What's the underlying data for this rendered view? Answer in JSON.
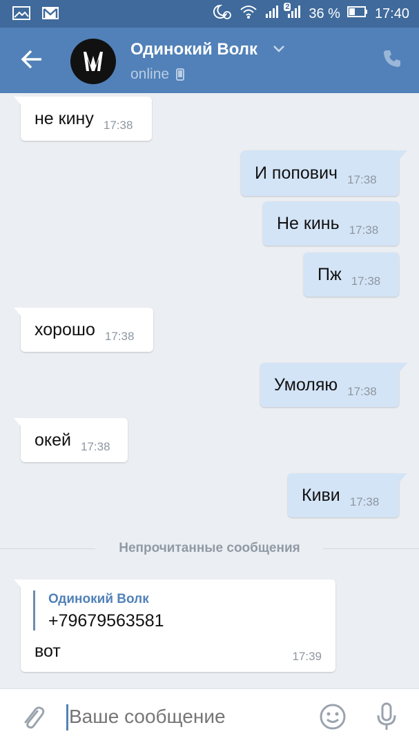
{
  "statusbar": {
    "signal_badge": "2",
    "battery": "36 %",
    "time": "17:40"
  },
  "header": {
    "name": "Одинокий Волк",
    "status": "online"
  },
  "messages": [
    {
      "dir": "in",
      "text": "не кину",
      "time": "17:38"
    },
    {
      "dir": "out",
      "text": "И попович",
      "time": "17:38"
    },
    {
      "dir": "out",
      "text": "Не кинь",
      "time": "17:38"
    },
    {
      "dir": "out",
      "text": "Пж",
      "time": "17:38"
    },
    {
      "dir": "in",
      "text": "хорошо",
      "time": "17:38"
    },
    {
      "dir": "out",
      "text": "Умоляю",
      "time": "17:38"
    },
    {
      "dir": "in",
      "text": "окей",
      "time": "17:38"
    },
    {
      "dir": "out",
      "text": "Киви",
      "time": "17:38"
    }
  ],
  "divider": "Непрочитанные сообщения",
  "forwarded": {
    "author": "Одинокий Волк",
    "quoted": "+79679563581",
    "text": "вот",
    "time": "17:39"
  },
  "input": {
    "placeholder": "Ваше сообщение"
  },
  "colors": {
    "header": "#5181b8",
    "statusbar": "#3f6a9b",
    "outgoing_bubble": "#d4e4f7",
    "incoming_bubble": "#ffffff",
    "background": "#ebeef2"
  }
}
